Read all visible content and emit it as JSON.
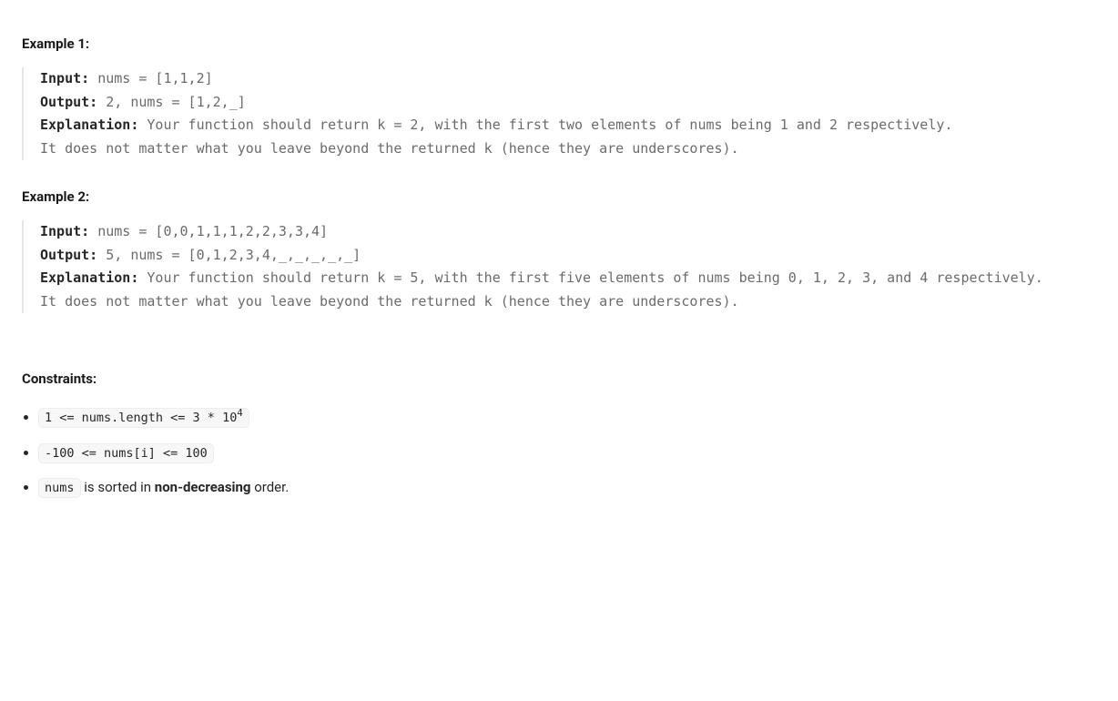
{
  "example1": {
    "heading": "Example 1:",
    "input_label": "Input:",
    "input_value": " nums = [1,1,2]",
    "output_label": "Output:",
    "output_value": " 2, nums = [1,2,_]",
    "explanation_label": "Explanation:",
    "explanation_value": " Your function should return k = 2, with the first two elements of nums being 1 and 2 respectively.\nIt does not matter what you leave beyond the returned k (hence they are underscores)."
  },
  "example2": {
    "heading": "Example 2:",
    "input_label": "Input:",
    "input_value": " nums = [0,0,1,1,1,2,2,3,3,4]",
    "output_label": "Output:",
    "output_value": " 5, nums = [0,1,2,3,4,_,_,_,_,_]",
    "explanation_label": "Explanation:",
    "explanation_value": " Your function should return k = 5, with the first five elements of nums being 0, 1, 2, 3, and 4 respectively.\nIt does not matter what you leave beyond the returned k (hence they are underscores)."
  },
  "constraints": {
    "heading": "Constraints:",
    "item1_prefix": "1 <= nums.length <= 3 * 10",
    "item1_exp": "4",
    "item2": "-100 <= nums[i] <= 100",
    "item3_code": "nums",
    "item3_mid": " is sorted in ",
    "item3_strong": "non-decreasing",
    "item3_suffix": " order."
  }
}
